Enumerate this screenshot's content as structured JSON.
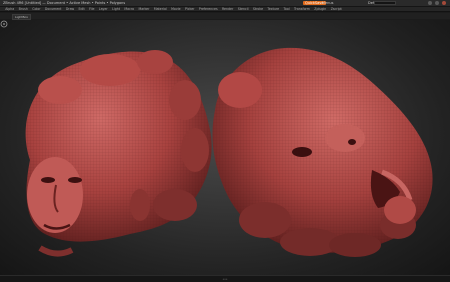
{
  "app": {
    "title": "ZBrush 4R6 [Untitled]  —  Document  •  Active Mesh  •  Points  •  Polygons",
    "quicksave_label": "QuickSave",
    "menus_label": "Menus",
    "script_label": "DefaultZScript"
  },
  "menubar": {
    "items": [
      "Alpha",
      "Brush",
      "Color",
      "Document",
      "Draw",
      "Edit",
      "File",
      "Layer",
      "Light",
      "Macro",
      "Marker",
      "Material",
      "Movie",
      "Picker",
      "Preferences",
      "Render",
      "Stencil",
      "Stroke",
      "Texture",
      "Tool",
      "Transform",
      "Zplugin",
      "Zscript"
    ]
  },
  "shelf": {
    "lightbox_label": "LightBox"
  },
  "statusbar": {
    "text": "•••"
  },
  "colors": {
    "accent": "#e06a1b",
    "sculpt": "#b24a47",
    "background": "#1b1b1b"
  },
  "icons": {
    "rotate": "rotate-view-icon"
  }
}
